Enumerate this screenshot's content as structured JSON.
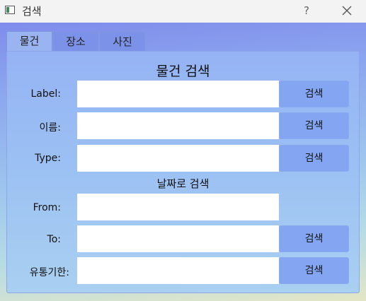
{
  "window": {
    "title": "검색",
    "help_label": "?",
    "icons": {
      "app": "app-window-icon",
      "close": "close-icon"
    }
  },
  "tabs": [
    {
      "label": "물건",
      "active": true
    },
    {
      "label": "장소",
      "active": false
    },
    {
      "label": "사진",
      "active": false
    }
  ],
  "sections": {
    "item_search_title": "물건 검색",
    "date_search_title": "날짜로 검색"
  },
  "fields": {
    "label": {
      "label": "Label:",
      "value": "",
      "button": "검색"
    },
    "name": {
      "label": "이름:",
      "value": "",
      "button": "검색"
    },
    "type": {
      "label": "Type:",
      "value": "",
      "button": "검색"
    },
    "from": {
      "label": "From:",
      "value": ""
    },
    "to": {
      "label": "To:",
      "value": "",
      "button": "검색"
    },
    "expiry": {
      "label": "유통기한:",
      "value": "",
      "button": "검색"
    }
  },
  "colors": {
    "button": "#84a6f2",
    "active_tab": "#9ab3f1",
    "inactive_tab": "#7c91e8",
    "titlebar": "#f3f3f3"
  }
}
